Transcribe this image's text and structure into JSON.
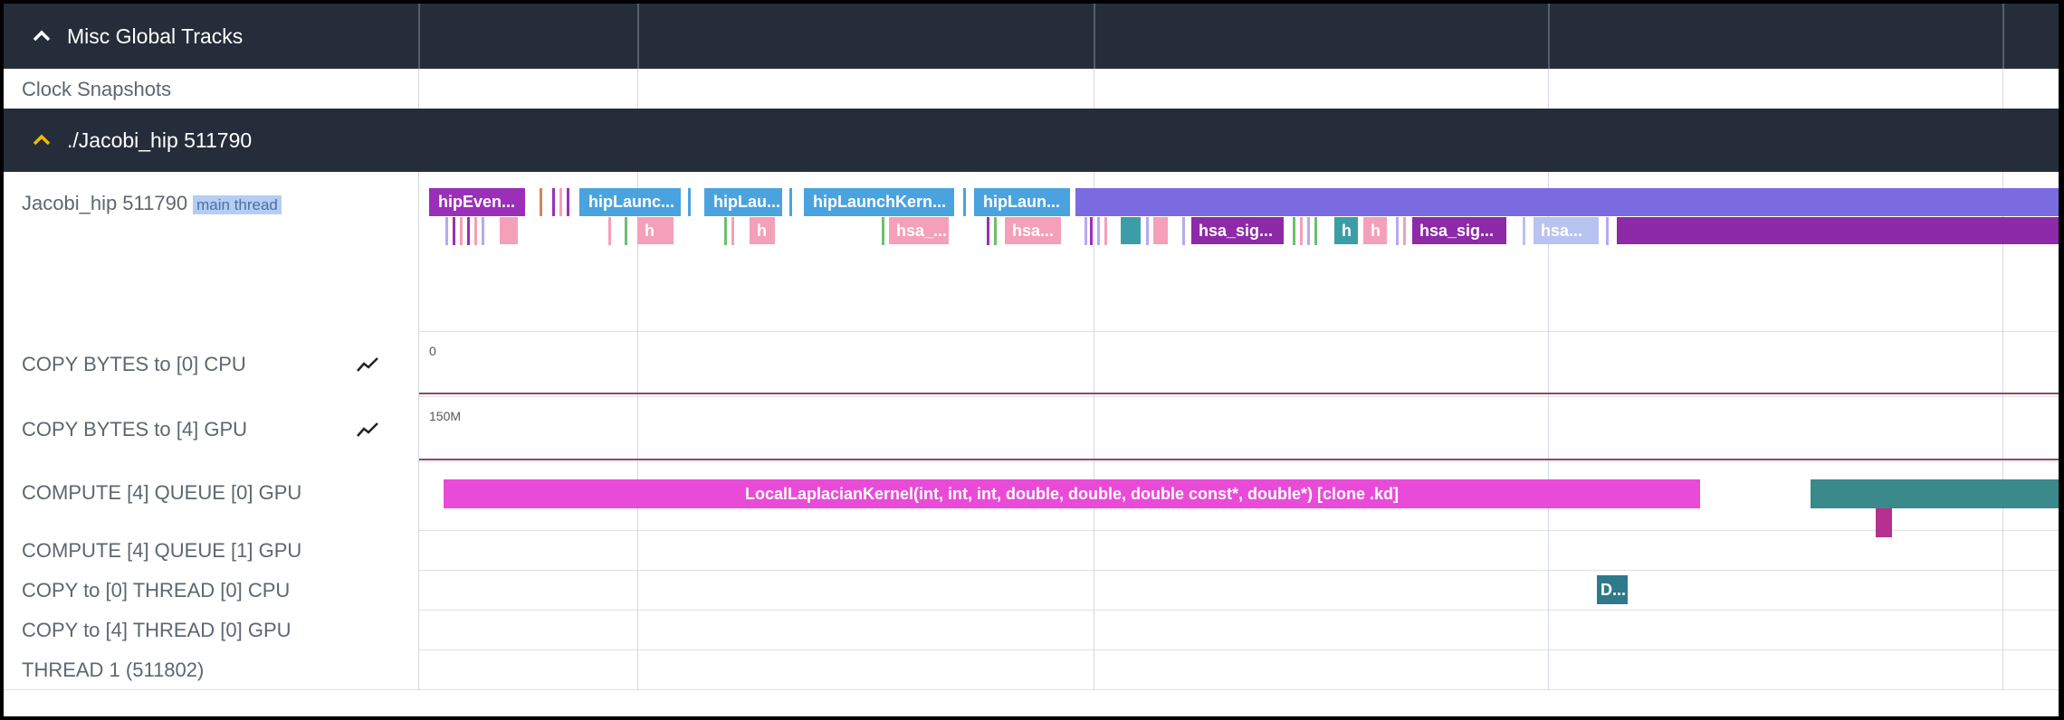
{
  "groups": {
    "misc": {
      "title": "Misc Global Tracks",
      "chevron_color": "#ffffff"
    },
    "process": {
      "title": "./Jacobi_hip 511790",
      "chevron_color": "#f5b800"
    }
  },
  "tracks": {
    "clock": {
      "name": "Clock Snapshots"
    },
    "main": {
      "name": "Jacobi_hip 511790",
      "chip": "main thread"
    },
    "copy_cpu": {
      "name": "COPY BYTES to [0] CPU",
      "axis_label": "0",
      "icon": "line-chart-icon"
    },
    "copy_gpu": {
      "name": "COPY BYTES to [4] GPU",
      "axis_label": "150M",
      "icon": "line-chart-icon"
    },
    "compute0": {
      "name": "COMPUTE [4] QUEUE [0] GPU",
      "kernel": "LocalLaplacianKernel(int, int, int, double, double, double const*, double*) [clone .kd]"
    },
    "compute1": {
      "name": "COMPUTE [4] QUEUE [1] GPU"
    },
    "copy_thread_cpu": {
      "name": "COPY to [0] THREAD [0] CPU",
      "slice": "D..."
    },
    "copy_thread_gpu": {
      "name": "COPY to [4] THREAD [0] GPU"
    },
    "thread1": {
      "name": "THREAD 1 (511802)"
    }
  },
  "slices_row1": [
    {
      "label": "hipEven...",
      "color": "#9a2fb8"
    },
    {
      "label": "hipLaunc...",
      "color": "#4aa3df"
    },
    {
      "label": "hipLau...",
      "color": "#4aa3df"
    },
    {
      "label": "hipLaunchKern...",
      "color": "#4aa3df"
    },
    {
      "label": "hipLaun...",
      "color": "#4aa3df"
    },
    {
      "label": "",
      "color": "#7b6be0"
    }
  ],
  "slices_row2": [
    {
      "label": "h",
      "color": "#f4a0b8"
    },
    {
      "label": "h",
      "color": "#f4a0b8"
    },
    {
      "label": "hsa_...",
      "color": "#f4a0b8"
    },
    {
      "label": "hsa...",
      "color": "#f4a0b8"
    },
    {
      "label": "hsa_sig...",
      "color": "#8d2aa8"
    },
    {
      "label": "h",
      "color": "#3b9ea6"
    },
    {
      "label": "h",
      "color": "#f4a0b8"
    },
    {
      "label": "hsa_sig...",
      "color": "#8d2aa8"
    },
    {
      "label": "hsa...",
      "color": "#b8c3f0"
    }
  ],
  "colors": {
    "kernel": "#e94bd8",
    "teal": "#3a8a8c",
    "header": "#252d3a"
  }
}
